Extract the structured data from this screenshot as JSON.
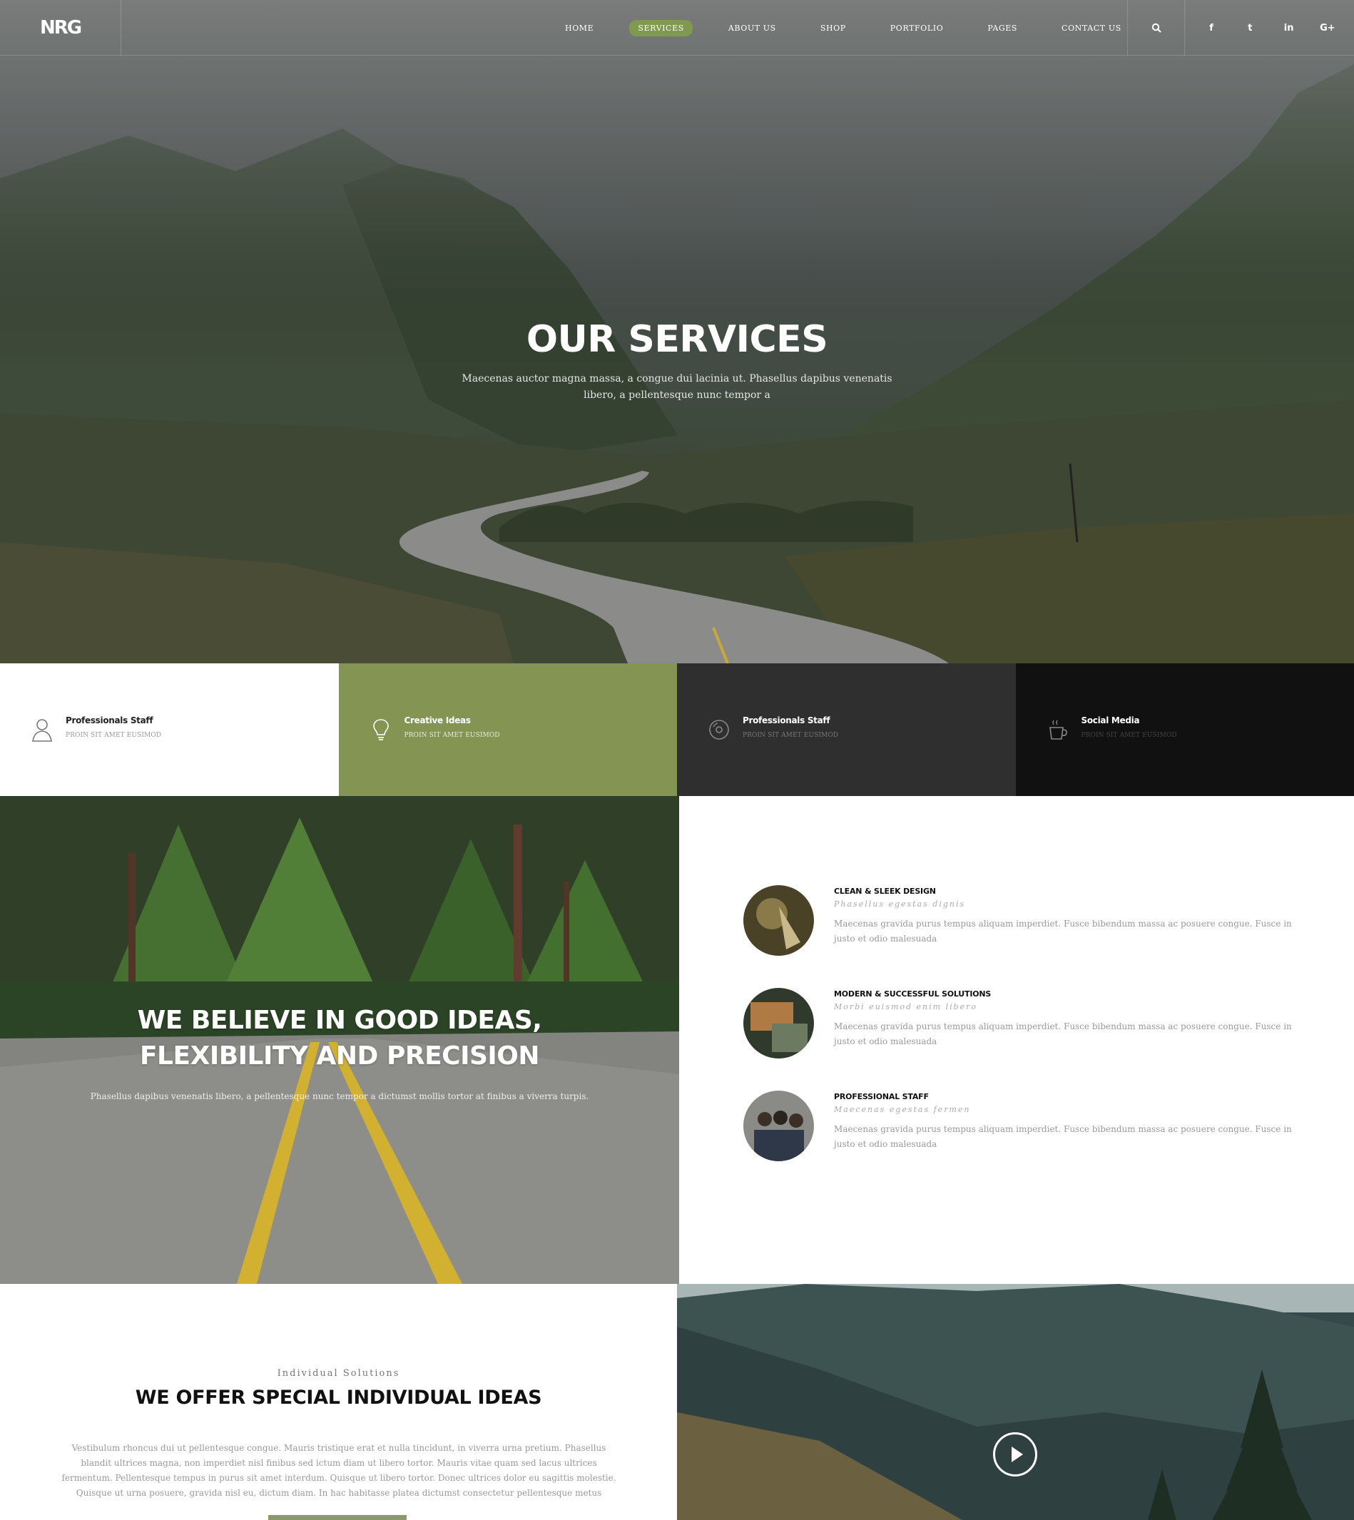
{
  "header": {
    "logo": "NRG",
    "nav": [
      "HOME",
      "SERVICES",
      "ABOUT US",
      "SHOP",
      "PORTFOLIO",
      "PAGES",
      "CONTACT US"
    ],
    "active_nav": "SERVICES",
    "social": [
      "f",
      "t",
      "in",
      "G+"
    ]
  },
  "hero": {
    "title": "OUR SERVICES",
    "subtitle": "Maecenas auctor magna massa, a congue dui lacinia ut. Phasellus dapibus venenatis libero, a pellentesque nunc tempor a"
  },
  "tiles": [
    {
      "title": "Professionals Staff",
      "sub": "PROIN SIT AMET EUSIMOD",
      "icon": "user-icon",
      "bg": "#ffffff",
      "fg": "#222222",
      "sub_color": "#999999"
    },
    {
      "title": "Creative Ideas",
      "sub": "PROIN SIT AMET EUSIMOD",
      "icon": "lightbulb-icon",
      "bg": "#849452",
      "fg": "#ffffff",
      "sub_color": "#e9eedb"
    },
    {
      "title": "Professionals Staff",
      "sub": "PROIN SIT AMET EUSIMOD",
      "icon": "disc-icon",
      "bg": "#2f2f2f",
      "fg": "#ffffff",
      "sub_color": "#777777"
    },
    {
      "title": "Social Media",
      "sub": "PROIN SIT AMET EUSIMOD",
      "icon": "coffee-cup-icon",
      "bg": "#111111",
      "fg": "#ffffff",
      "sub_color": "#444444"
    }
  ],
  "believe": {
    "title_line1": "WE BELIEVE IN GOOD IDEAS,",
    "title_line2": "FLEXIBILITY AND PRECISION",
    "subtitle": "Phasellus dapibus venenatis libero, a pellentesque nunc tempor a dictumst mollis tortor at finibus a viverra turpis."
  },
  "features": [
    {
      "title": "CLEAN & SLEEK DESIGN",
      "sub": "Phasellus egestas dignis",
      "text": "Maecenas gravida purus tempus aliquam imperdiet. Fusce bibendum massa ac posuere congue. Fusce in justo et odio malesuada"
    },
    {
      "title": "MODERN & SUCCESSFUL SOLUTIONS",
      "sub": "Morbi euismod enim libero",
      "text": "Maecenas gravida purus tempus aliquam imperdiet. Fusce bibendum massa ac posuere congue. Fusce in justo et odio malesuada"
    },
    {
      "title": "PROFESSIONAL STAFF",
      "sub": "Maecenas egestas fermen",
      "text": "Maecenas gravida purus tempus aliquam imperdiet. Fusce bibendum massa ac posuere congue. Fusce in justo et odio malesuada"
    }
  ],
  "offer": {
    "kicker": "Individual Solutions",
    "title": "WE OFFER SPECIAL INDIVIDUAL IDEAS",
    "text": "Vestibulum rhoncus dui ut pellentesque congue. Mauris tristique erat et nulla tincidunt, in viverra urna pretium. Phasellus blandit ultrices magna, non imperdiet nisl finibus sed ictum diam ut libero tortor. Mauris vitae quam sed lacus ultrices fermentum. Pellentesque tempus in purus sit amet interdum. Quisque ut libero tortor. Donec ultrices dolor eu sagittis molestie. Quisque ut urna posuere, gravida nisl eu, dictum diam. In hac habitasse platea dictumst consectetur pellentesque metus"
  },
  "colors": {
    "accent": "#7f9a4f",
    "dark": "#2f2f2f",
    "black": "#111111"
  }
}
